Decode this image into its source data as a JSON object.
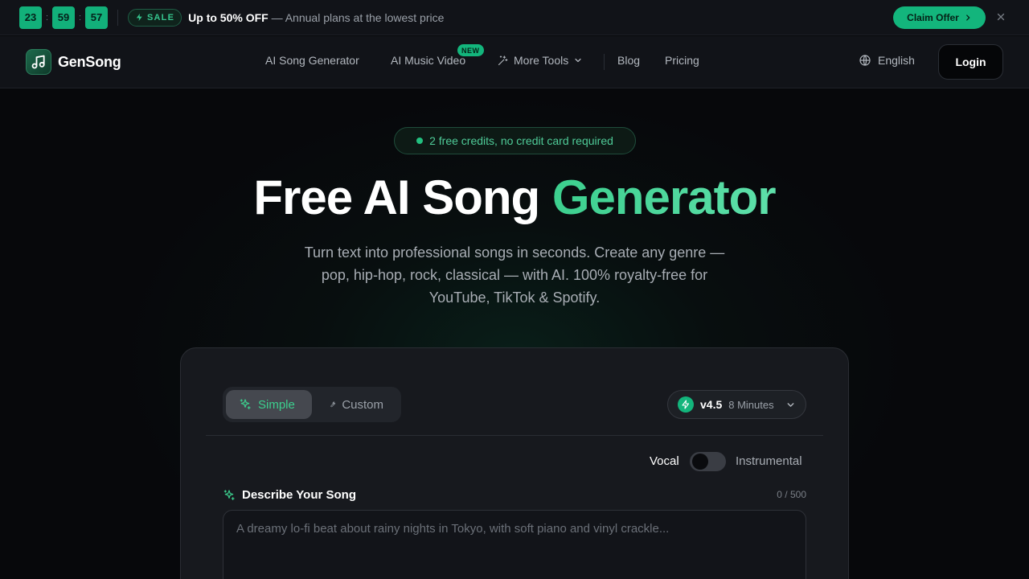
{
  "promo": {
    "timer": {
      "hours": "23",
      "minutes": "59",
      "seconds": "57"
    },
    "sale_badge": "SALE",
    "offer_bold": "Up to 50% OFF",
    "offer_rest": " — Annual plans at the lowest price",
    "claim_button": "Claim Offer"
  },
  "nav": {
    "brand": "GenSong",
    "links": {
      "song_generator": "AI Song Generator",
      "music_video": "AI Music Video",
      "more_tools": "More Tools",
      "blog": "Blog",
      "pricing": "Pricing"
    },
    "new_badge": "NEW",
    "language": "English",
    "login": "Login"
  },
  "hero": {
    "pill": "2 free credits, no credit card required",
    "title_main": "Free AI Song ",
    "title_accent": "Generator",
    "subtitle": "Turn text into professional songs in seconds. Create any genre — pop, hip-hop, rock, classical — with AI. 100% royalty-free for YouTube, TikTok & Spotify."
  },
  "generator": {
    "modes": {
      "simple": "Simple",
      "custom": "Custom"
    },
    "model": {
      "version": "v4.5",
      "duration": "8 Minutes"
    },
    "vocal_label": "Vocal",
    "instrumental_label": "Instrumental",
    "vocal_enabled": false,
    "describe_label": "Describe Your Song",
    "char_count": "0 / 500",
    "prompt": {
      "value": "",
      "placeholder": "A dreamy lo-fi beat about rainy nights in Tokyo, with soft piano and vinyl crackle..."
    }
  },
  "colors": {
    "accent": "#13b57c",
    "accent_text": "#3ccf8e",
    "background": "#07080b",
    "card": "#17191e"
  },
  "icons": {
    "sale": "lightning-icon",
    "claim": "chevron-right-icon",
    "close": "close-icon",
    "logo": "music-note-icon",
    "more_tools": "sparkles-icon",
    "language": "globe-icon",
    "simple_mode": "sparkles-icon",
    "custom_mode": "wrench-icon",
    "model": "lightning-icon",
    "describe": "sparkles-icon"
  }
}
